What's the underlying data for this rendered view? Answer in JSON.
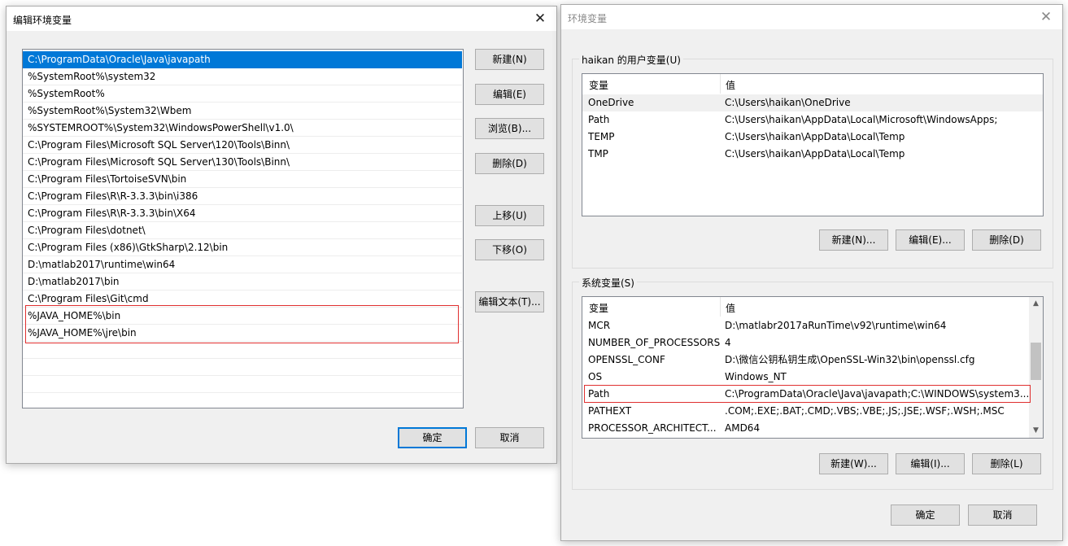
{
  "edit_dialog": {
    "title": "编辑环境变量",
    "close_icon": "close-icon",
    "paths": [
      "C:\\ProgramData\\Oracle\\Java\\javapath",
      "%SystemRoot%\\system32",
      "%SystemRoot%",
      "%SystemRoot%\\System32\\Wbem",
      "%SYSTEMROOT%\\System32\\WindowsPowerShell\\v1.0\\",
      "C:\\Program Files\\Microsoft SQL Server\\120\\Tools\\Binn\\",
      "C:\\Program Files\\Microsoft SQL Server\\130\\Tools\\Binn\\",
      "C:\\Program Files\\TortoiseSVN\\bin",
      "C:\\Program Files\\R\\R-3.3.3\\bin\\i386",
      "C:\\Program Files\\R\\R-3.3.3\\bin\\X64",
      "C:\\Program Files\\dotnet\\",
      "C:\\Program Files (x86)\\GtkSharp\\2.12\\bin",
      "D:\\matlab2017\\runtime\\win64",
      "D:\\matlab2017\\bin",
      "C:\\Program Files\\Git\\cmd",
      "%JAVA_HOME%\\bin",
      "%JAVA_HOME%\\jre\\bin"
    ],
    "buttons": {
      "new": "新建(N)",
      "edit": "编辑(E)",
      "browse": "浏览(B)...",
      "delete": "删除(D)",
      "move_up": "上移(U)",
      "move_down": "下移(O)",
      "edit_text": "编辑文本(T)...",
      "ok": "确定",
      "cancel": "取消"
    }
  },
  "env_dialog": {
    "title": "环境变量",
    "close_icon": "close-icon",
    "user_group_title": "haikan 的用户变量(U)",
    "user_columns": [
      "变量",
      "值"
    ],
    "user_vars": [
      {
        "name": "OneDrive",
        "value": "C:\\Users\\haikan\\OneDrive"
      },
      {
        "name": "Path",
        "value": "C:\\Users\\haikan\\AppData\\Local\\Microsoft\\WindowsApps;"
      },
      {
        "name": "TEMP",
        "value": "C:\\Users\\haikan\\AppData\\Local\\Temp"
      },
      {
        "name": "TMP",
        "value": "C:\\Users\\haikan\\AppData\\Local\\Temp"
      }
    ],
    "user_buttons": {
      "new": "新建(N)...",
      "edit": "编辑(E)...",
      "delete": "删除(D)"
    },
    "system_group_title": "系统变量(S)",
    "system_columns": [
      "变量",
      "值"
    ],
    "system_vars": [
      {
        "name": "MCR",
        "value": "D:\\matlabr2017aRunTime\\v92\\runtime\\win64"
      },
      {
        "name": "NUMBER_OF_PROCESSORS",
        "value": "4"
      },
      {
        "name": "OPENSSL_CONF",
        "value": "D:\\微信公钥私钥生成\\OpenSSL-Win32\\bin\\openssl.cfg"
      },
      {
        "name": "OS",
        "value": "Windows_NT"
      },
      {
        "name": "Path",
        "value": "C:\\ProgramData\\Oracle\\Java\\javapath;C:\\WINDOWS\\system3..."
      },
      {
        "name": "PATHEXT",
        "value": ".COM;.EXE;.BAT;.CMD;.VBS;.VBE;.JS;.JSE;.WSF;.WSH;.MSC"
      },
      {
        "name": "PROCESSOR_ARCHITECT...",
        "value": "AMD64"
      }
    ],
    "system_buttons": {
      "new": "新建(W)...",
      "edit": "编辑(I)...",
      "delete": "删除(L)"
    },
    "ok": "确定",
    "cancel": "取消"
  },
  "colors": {
    "selection": "#0078d7",
    "highlight_border": "#e03030",
    "dialog_bg": "#f0f0f0"
  }
}
